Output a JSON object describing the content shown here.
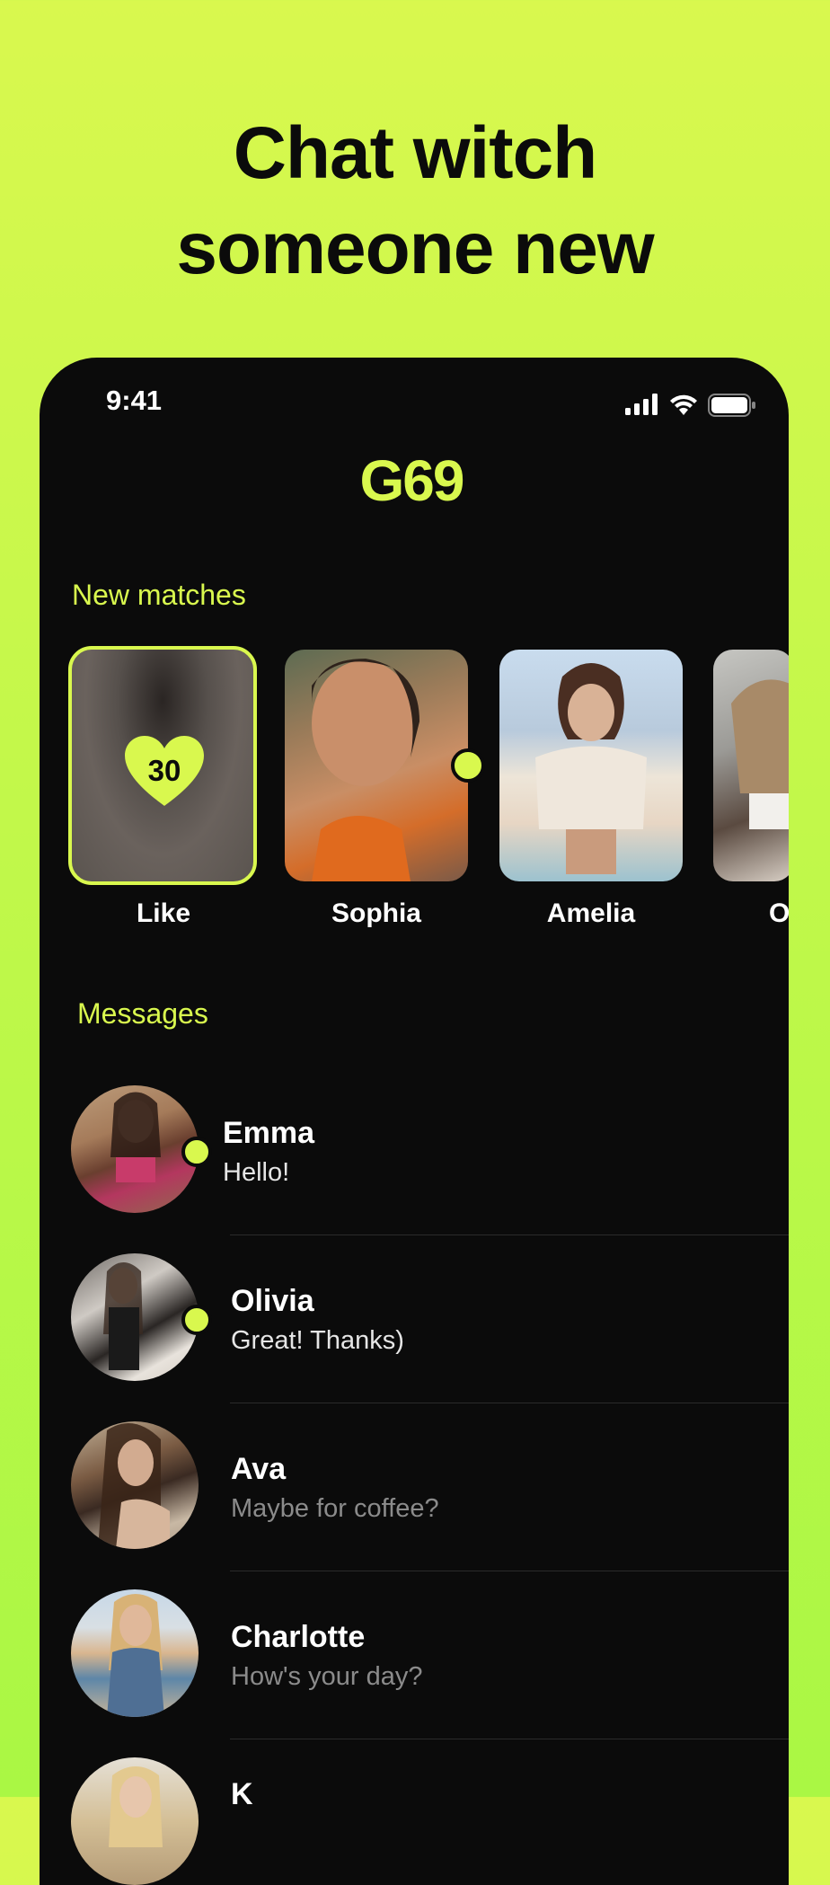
{
  "headline": {
    "line1": "Chat witch",
    "line2": "someone new"
  },
  "status_bar": {
    "time": "9:41",
    "icons": [
      "cellular-signal-icon",
      "wifi-icon",
      "battery-icon"
    ]
  },
  "app": {
    "logo": "G69"
  },
  "new_matches": {
    "title": "New matches",
    "like_card": {
      "label": "Like",
      "count": "30"
    },
    "cards": [
      {
        "name": "Sophia",
        "online": true
      },
      {
        "name": "Amelia",
        "online": false
      },
      {
        "name": "O",
        "online": false
      }
    ]
  },
  "messages": {
    "title": "Messages",
    "items": [
      {
        "name": "Emma",
        "text": "Hello!",
        "unread": true
      },
      {
        "name": "Olivia",
        "text": "Great! Thanks)",
        "unread": true
      },
      {
        "name": "Ava",
        "text": "Maybe for coffee?",
        "unread": false
      },
      {
        "name": "Charlotte",
        "text": "How's your day?",
        "unread": false
      },
      {
        "name": "K",
        "text": "",
        "unread": false
      }
    ]
  },
  "colors": {
    "accent": "#d9f84e",
    "background": "#0b0b0b",
    "page_gradient_top": "#d9f84e",
    "page_gradient_bottom": "#aaf744"
  }
}
